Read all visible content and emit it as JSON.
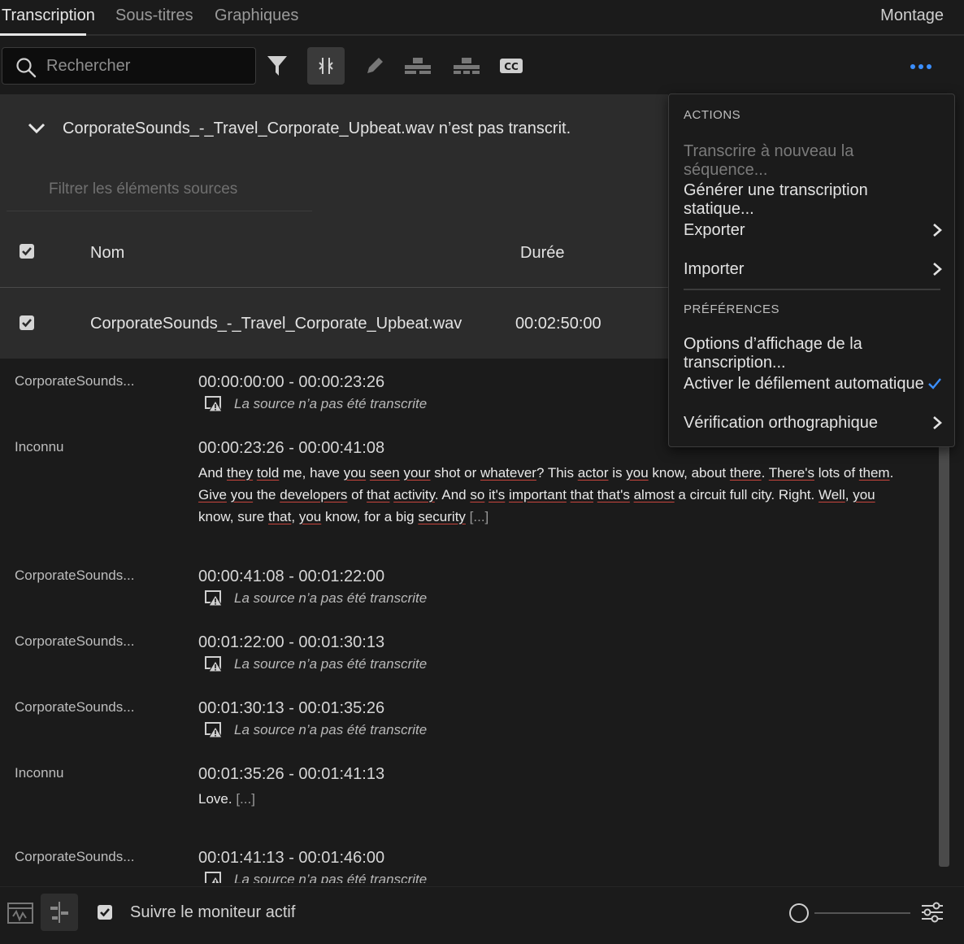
{
  "tabs": {
    "transcription": "Transcription",
    "subtitles": "Sous-titres",
    "graphics": "Graphiques",
    "workspace": "Montage"
  },
  "search": {
    "placeholder": "Rechercher"
  },
  "notice": {
    "text": "CorporateSounds_-_Travel_Corporate_Upbeat.wav n’est pas transcrit."
  },
  "source_filter": {
    "placeholder": "Filtrer les éléments sources"
  },
  "table": {
    "col_name": "Nom",
    "col_duration": "Durée",
    "rows": [
      {
        "name": "CorporateSounds_-_Travel_Corporate_Upbeat.wav",
        "duration": "00:02:50:00",
        "checked": true
      }
    ]
  },
  "transcript": {
    "not_transcribed": "La source n’a pas été transcrite",
    "entries": [
      {
        "speaker": "CorporateSounds...",
        "timecode": "00:00:00:00 - 00:00:23:26"
      },
      {
        "speaker": "Inconnu",
        "timecode": "00:00:23:26 - 00:00:41:08"
      },
      {
        "speaker": "CorporateSounds...",
        "timecode": "00:00:41:08 - 00:01:22:00"
      },
      {
        "speaker": "CorporateSounds...",
        "timecode": "00:01:22:00 - 00:01:30:13"
      },
      {
        "speaker": "CorporateSounds...",
        "timecode": "00:01:30:13 - 00:01:35:26"
      },
      {
        "speaker": "Inconnu",
        "timecode": "00:01:35:26 - 00:01:41:13",
        "text": "Love.",
        "ellipsis": "[...]"
      },
      {
        "speaker": "CorporateSounds...",
        "timecode": "00:01:41:13 - 00:01:46:00"
      }
    ],
    "entry2_words": [
      "And",
      "they",
      "told",
      "me, have",
      "you",
      "seen",
      "your",
      "shot or",
      "whatever",
      "? This",
      "actor",
      "is",
      "you",
      "know, about",
      "there",
      ".",
      "There's",
      "lots of",
      "them",
      ".",
      "Give",
      "you",
      "the",
      "developers",
      "of",
      "that",
      "activity",
      ". And",
      "so",
      "it's",
      "important",
      "that",
      "that's",
      "almost",
      "a circuit full city. Right.",
      "Well",
      ",",
      "you",
      "know, sure",
      "that",
      ",",
      "you",
      "know, for a big",
      "security",
      "[...]"
    ]
  },
  "menu": {
    "section_actions": "ACTIONS",
    "retranscribe": "Transcrire à nouveau la séquence...",
    "generate_static": "Générer une transcription statique...",
    "export": "Exporter",
    "import": "Importer",
    "section_prefs": "PRÉFÉRENCES",
    "display_options": "Options d’affichage de la transcription...",
    "autoscroll": "Activer le défilement automatique",
    "autoscroll_checked": true,
    "spellcheck": "Vérification orthographique"
  },
  "footer": {
    "follow_monitor": "Suivre le moniteur actif",
    "follow_checked": true
  },
  "colors": {
    "accent": "#3b8fff",
    "spell_underline": "#c8453d"
  }
}
